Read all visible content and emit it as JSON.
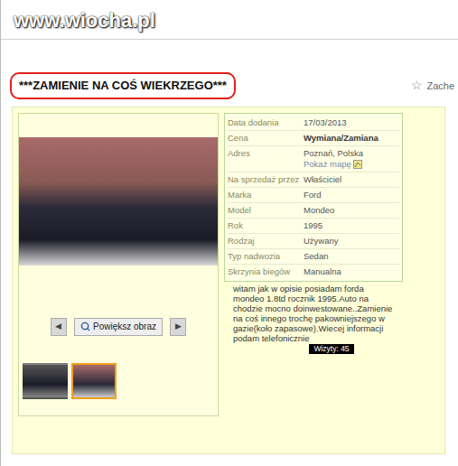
{
  "watermark": "www.wiocha.pl",
  "title": "***ZAMIENIE NA COŚ WIEKRZEGO***",
  "watch": {
    "icon": "☆",
    "label": "Zache"
  },
  "gallery": {
    "prev": "◀",
    "zoom": "Powiększ obraz",
    "next": "▶",
    "thumbnails": [
      {
        "selected": false
      },
      {
        "selected": true
      }
    ]
  },
  "details": [
    {
      "label": "Data dodania",
      "value": "17/03/2013",
      "bold": false
    },
    {
      "label": "Cena",
      "value": "Wymiana/Zamiana",
      "bold": true
    },
    {
      "label": "Adres",
      "value": "Poznań, Polska",
      "bold": false,
      "link": "Pokaż mapę"
    },
    {
      "label": "Na sprzedaż przez",
      "value": "Właściciel",
      "bold": false
    },
    {
      "label": "Marka",
      "value": "Ford",
      "bold": false
    },
    {
      "label": "Model",
      "value": "Mondeo",
      "bold": false
    },
    {
      "label": "Rok",
      "value": "1995",
      "bold": false
    },
    {
      "label": "Rodzaj",
      "value": "Używany",
      "bold": false
    },
    {
      "label": "Typ nadwozia",
      "value": "Sedan",
      "bold": false
    },
    {
      "label": "Skrzynia biegów",
      "value": "Manualna",
      "bold": false
    }
  ],
  "description": "witam jak w opisie posiadam forda mondeo 1.8td rocznik 1995.Auto na chodzie mocno doinwestowane..Zamienie na coś innego trochę pakowniejszego w gazie(koło zapasowe).Wiecej informacji podam telefonicznie",
  "visits": "Wizyty: 45"
}
